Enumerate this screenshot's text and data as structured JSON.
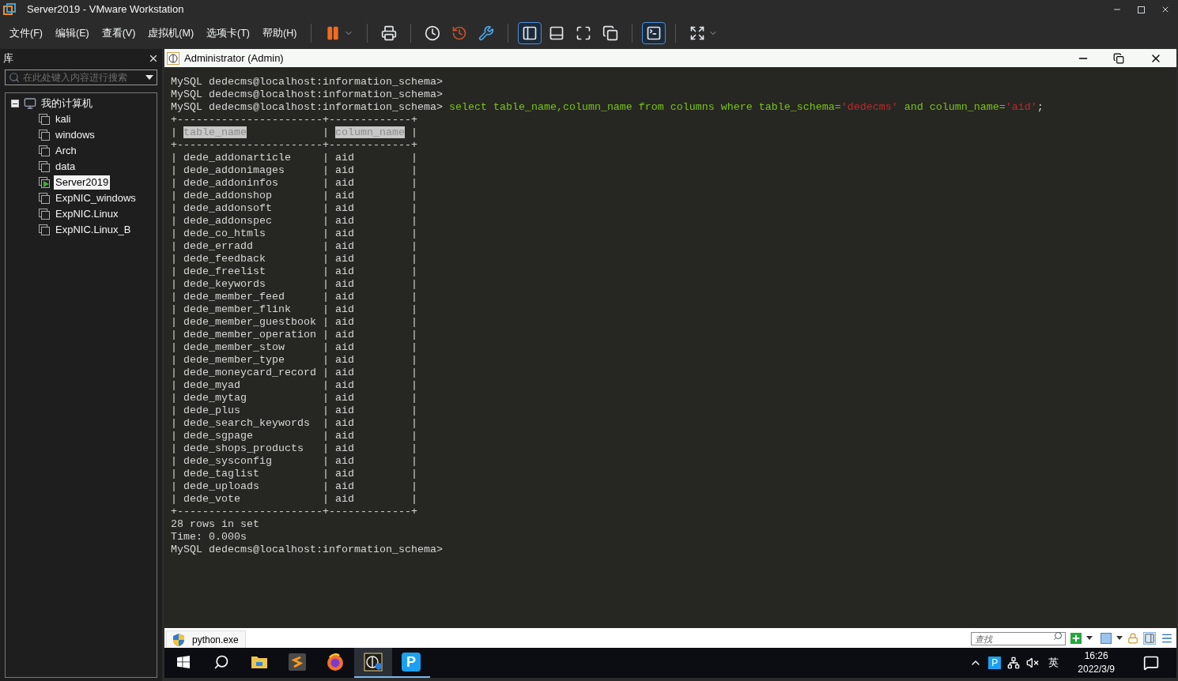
{
  "window": {
    "title": "Server2019 - VMware Workstation"
  },
  "menu": [
    "文件(F)",
    "编辑(E)",
    "查看(V)",
    "虚拟机(M)",
    "选项卡(T)",
    "帮助(H)"
  ],
  "toolbar": [
    {
      "kind": "pause",
      "selected": false
    },
    {
      "kind": "send-keys",
      "selected": false
    },
    {
      "kind": "snapshot",
      "selected": false
    },
    {
      "kind": "revert",
      "selected": false
    },
    {
      "kind": "manage",
      "selected": false
    },
    {
      "kind": "library",
      "selected": true
    },
    {
      "kind": "thumbnail",
      "selected": false
    },
    {
      "kind": "fullscreen",
      "selected": false
    },
    {
      "kind": "unity",
      "selected": false
    },
    {
      "kind": "console",
      "selected": true
    },
    {
      "kind": "stretch",
      "selected": false
    }
  ],
  "library": {
    "title": "库",
    "search": {
      "placeholder": "在此处键入内容进行搜索"
    },
    "tree": [
      {
        "label": "我的计算机",
        "expanded": true,
        "children": [
          {
            "label": "kali",
            "selected": false,
            "running": false
          },
          {
            "label": "windows",
            "selected": false,
            "running": false
          },
          {
            "label": "Arch",
            "selected": false,
            "running": false
          },
          {
            "label": "data",
            "selected": false,
            "running": false
          },
          {
            "label": "Server2019",
            "selected": true,
            "running": true
          },
          {
            "label": "ExpNIC_windows",
            "selected": false,
            "running": false
          },
          {
            "label": "ExpNIC.Linux",
            "selected": false,
            "running": false
          },
          {
            "label": "ExpNIC.Linux_B",
            "selected": false,
            "running": false
          }
        ]
      }
    ]
  },
  "console": {
    "title": "Administrator (Admin)",
    "lines": [
      {
        "kind": "plain",
        "text": "MySQL dedecms@localhost:information_schema>"
      },
      {
        "kind": "plain",
        "text": "MySQL dedecms@localhost:information_schema>"
      },
      {
        "kind": "command",
        "segments": [
          {
            "kind": "plain",
            "text": "MySQL dedecms@localhost:information_schema> "
          },
          {
            "kind": "keyword",
            "text": "select table_name,column_name from columns where table_schema="
          },
          {
            "kind": "string",
            "text": "'dedecms'"
          },
          {
            "kind": "keyword",
            "text": " and column_name="
          },
          {
            "kind": "string",
            "text": "'aid'"
          },
          {
            "kind": "plain",
            "text": ";"
          }
        ]
      },
      {
        "kind": "plain",
        "text": "+-----------------------+-------------+"
      },
      {
        "kind": "command",
        "segments": [
          {
            "kind": "plain",
            "text": "| "
          },
          {
            "kind": "header",
            "text": "table_name"
          },
          {
            "kind": "plain",
            "text": "            | "
          },
          {
            "kind": "header",
            "text": "column_name"
          },
          {
            "kind": "plain",
            "text": " |"
          }
        ]
      },
      {
        "kind": "plain",
        "text": "+-----------------------+-------------+"
      },
      {
        "kind": "plain",
        "text": "| dede_addonarticle     | aid         |"
      },
      {
        "kind": "plain",
        "text": "| dede_addonimages      | aid         |"
      },
      {
        "kind": "plain",
        "text": "| dede_addoninfos       | aid         |"
      },
      {
        "kind": "plain",
        "text": "| dede_addonshop        | aid         |"
      },
      {
        "kind": "plain",
        "text": "| dede_addonsoft        | aid         |"
      },
      {
        "kind": "plain",
        "text": "| dede_addonspec        | aid         |"
      },
      {
        "kind": "plain",
        "text": "| dede_co_htmls         | aid         |"
      },
      {
        "kind": "plain",
        "text": "| dede_erradd           | aid         |"
      },
      {
        "kind": "plain",
        "text": "| dede_feedback         | aid         |"
      },
      {
        "kind": "plain",
        "text": "| dede_freelist         | aid         |"
      },
      {
        "kind": "plain",
        "text": "| dede_keywords         | aid         |"
      },
      {
        "kind": "plain",
        "text": "| dede_member_feed      | aid         |"
      },
      {
        "kind": "plain",
        "text": "| dede_member_flink     | aid         |"
      },
      {
        "kind": "plain",
        "text": "| dede_member_guestbook | aid         |"
      },
      {
        "kind": "plain",
        "text": "| dede_member_operation | aid         |"
      },
      {
        "kind": "plain",
        "text": "| dede_member_stow      | aid         |"
      },
      {
        "kind": "plain",
        "text": "| dede_member_type      | aid         |"
      },
      {
        "kind": "plain",
        "text": "| dede_moneycard_record | aid         |"
      },
      {
        "kind": "plain",
        "text": "| dede_myad             | aid         |"
      },
      {
        "kind": "plain",
        "text": "| dede_mytag            | aid         |"
      },
      {
        "kind": "plain",
        "text": "| dede_plus             | aid         |"
      },
      {
        "kind": "plain",
        "text": "| dede_search_keywords  | aid         |"
      },
      {
        "kind": "plain",
        "text": "| dede_sgpage           | aid         |"
      },
      {
        "kind": "plain",
        "text": "| dede_shops_products   | aid         |"
      },
      {
        "kind": "plain",
        "text": "| dede_sysconfig        | aid         |"
      },
      {
        "kind": "plain",
        "text": "| dede_taglist          | aid         |"
      },
      {
        "kind": "plain",
        "text": "| dede_uploads          | aid         |"
      },
      {
        "kind": "plain",
        "text": "| dede_vote             | aid         |"
      },
      {
        "kind": "plain",
        "text": "+-----------------------+-------------+"
      },
      {
        "kind": "plain",
        "text": "28 rows in set"
      },
      {
        "kind": "plain",
        "text": "Time: 0.000s"
      },
      {
        "kind": "plain",
        "text": "MySQL dedecms@localhost:information_schema>"
      }
    ]
  },
  "tab_strip": {
    "tab": "python.exe",
    "search": {
      "placeholder": "查找"
    }
  },
  "taskbar": {
    "apps": [
      {
        "kind": "start",
        "selected": false,
        "open": false
      },
      {
        "kind": "search",
        "selected": false,
        "open": false
      },
      {
        "kind": "explorer",
        "selected": false,
        "open": false
      },
      {
        "kind": "editor",
        "selected": false,
        "open": false
      },
      {
        "kind": "browser",
        "selected": false,
        "open": false
      },
      {
        "kind": "console",
        "selected": true,
        "open": true
      },
      {
        "kind": "letter",
        "label": "P",
        "selected": false,
        "open": true
      }
    ],
    "tray": {
      "badge": "P",
      "ime": "英",
      "time": "16:26",
      "date": "2022/3/9"
    }
  }
}
